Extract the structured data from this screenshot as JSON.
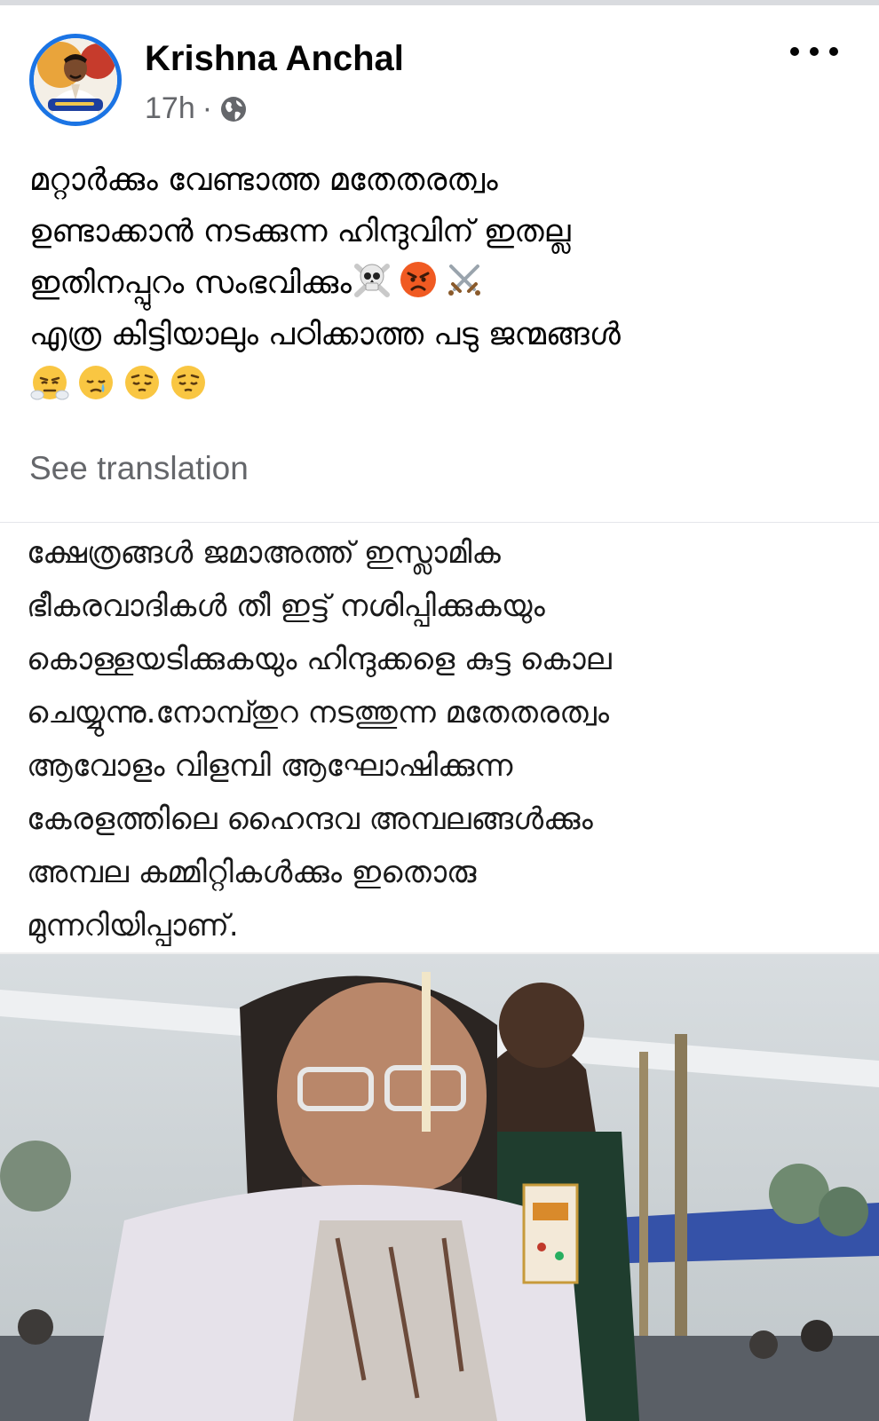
{
  "post": {
    "author_name": "Krishna Anchal",
    "timestamp": "17h",
    "separator": "·",
    "audience_icon": "globe-icon",
    "more_icon": "more-horizontal-icon",
    "caption_lines": [
      "മറ്റാർക്കും വേണ്ടാത്ത മതേതരത്വം",
      "ഉണ്ടാക്കാൻ നടക്കുന്ന ഹിന്ദുവിന് ഇതല്ല",
      "ഇതിനപ്പുറം സംഭവിക്കും",
      "എത്ര കിട്ടിയാലും പഠിക്കാത്ത പടു ജന്മങ്ങൾ"
    ],
    "caption_emojis_line3": [
      "skull-crossbones-emoji",
      "angry-face-emoji",
      "crossed-swords-emoji"
    ],
    "caption_emojis_line5": [
      "steaming-face-emoji",
      "crying-face-emoji",
      "pensive-face-emoji",
      "pensive-face-emoji"
    ],
    "see_translation": "See translation"
  },
  "shared_image": {
    "text_lines": [
      "ക്ഷേത്രങ്ങൾ ജമാഅത്ത് ഇസ്ലാമിക",
      "ഭീകരവാദികൾ  തീ ഇട്ട് നശിപ്പിക്കുകയും",
      "കൊള്ളയടിക്കുകയും ഹിന്ദുക്കളെ കുട്ട കൊല",
      "ചെയ്യുന്നു.നോമ്പ്തുറ നടത്തുന്ന മതേതരത്വം",
      "ആവോളം വിളമ്പി ആഘോഷിക്കുന്ന",
      "കേരളത്തിലെ ഹൈന്ദവ അമ്പലങ്ങൾക്കും",
      "അമ്പല കമ്മിറ്റികൾക്കും ഇതൊരു",
      "മുന്നറിയിപ്പാണ്."
    ]
  },
  "colors": {
    "avatar_ring": "#1b74e4",
    "secondary_text": "#65676b",
    "primary_text": "#050505"
  }
}
